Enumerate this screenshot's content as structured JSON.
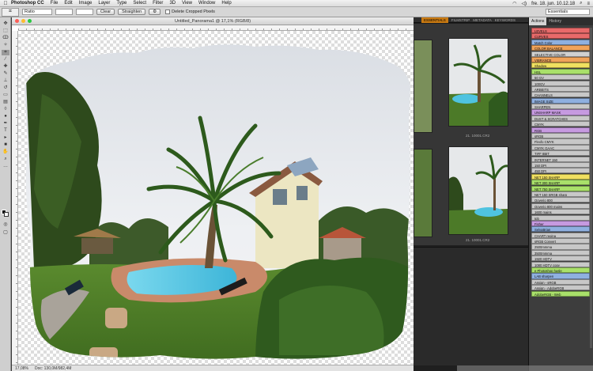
{
  "menubar": {
    "items": [
      "Photoshop CC",
      "File",
      "Edit",
      "Image",
      "Layer",
      "Type",
      "Select",
      "Filter",
      "3D",
      "View",
      "Window",
      "Help"
    ],
    "clock": "fre. 18. jun.  10.12.18"
  },
  "options": {
    "style_value": "Ratio",
    "clear_label": "Clear",
    "straighten_label": "Straighten",
    "delete_cropped_label": "Delete Cropped Pixels",
    "workspace": "Essentials"
  },
  "document": {
    "title": "Untitled_Panorama1 @ 17,1% (RGB/8)",
    "zoom": "17,08%",
    "doc_info": "Doc: 130,0M/982,4M"
  },
  "bridge": {
    "tabs": [
      "ESSENTIALS",
      "FILMSTRIP",
      "METADATA",
      "KEYWORDS"
    ],
    "thumb_labels": [
      "21. 10001.CR2",
      "21. 10001.CR2"
    ]
  },
  "panel": {
    "tabs": [
      "Actions",
      "History"
    ],
    "actions": [
      {
        "label": "LEVELS",
        "color": "#e86a6a"
      },
      {
        "label": "CURVES",
        "color": "#e86a6a"
      },
      {
        "label": "Match Color",
        "color": "#8fb0e0"
      },
      {
        "label": "COLOR BALANCE",
        "color": "#f0a35a"
      },
      {
        "label": "SELECTIVE COLOR",
        "color": "#d0d0d0"
      },
      {
        "label": "VIBRANCE",
        "color": "#f0a35a"
      },
      {
        "label": "Shadow",
        "color": "#f0e060"
      },
      {
        "label": "HSL",
        "color": "#a9e06a"
      },
      {
        "label": "50 GV",
        "color": "#c8c8c8"
      },
      {
        "label": "100GV",
        "color": "#c8c8c8"
      },
      {
        "label": "ARBEITS",
        "color": "#c8c8c8"
      },
      {
        "label": "CHANNELS",
        "color": "#c8c8c8"
      },
      {
        "label": "IMAGE SIZE",
        "color": "#8fb0e0"
      },
      {
        "label": "SHARPEN",
        "color": "#c8c8c8"
      },
      {
        "label": "UNSHARP MASK",
        "color": "#c69ae0"
      },
      {
        "label": "DUST & SCRATCHES",
        "color": "#c8c8c8"
      },
      {
        "label": "CMYK",
        "color": "#c8c8c8"
      },
      {
        "label": "RGB",
        "color": "#c69ae0"
      },
      {
        "label": "sRGB",
        "color": "#c8c8c8"
      },
      {
        "label": "Flexfo CMYK",
        "color": "#c8c8c8"
      },
      {
        "label": "CMYK GAAC",
        "color": "#c8c8c8"
      },
      {
        "label": "TIFF 8BIT",
        "color": "#c8c8c8"
      },
      {
        "label": "INTERNET 150",
        "color": "#c8c8c8"
      },
      {
        "label": "150 DPI",
        "color": "#c8c8c8"
      },
      {
        "label": "450 DPI",
        "color": "#c8c8c8"
      },
      {
        "label": "NET 150 SHARP",
        "color": "#f0e060"
      },
      {
        "label": "NET 300 SHARP",
        "color": "#a9e06a"
      },
      {
        "label": "NET 750 SHARP",
        "color": "#a9e06a"
      },
      {
        "label": "NET 150 SRGB sharp",
        "color": "#c8c8c8"
      },
      {
        "label": "Qoverjo 800",
        "color": "#c8c8c8"
      },
      {
        "label": "Qoverjo 800 mains",
        "color": "#c8c8c8"
      },
      {
        "label": "1600 mains",
        "color": "#c8c8c8"
      },
      {
        "label": "Ipb",
        "color": "#c8c8c8"
      },
      {
        "label": "Fisher",
        "color": "#c69ae0"
      },
      {
        "label": "SelvaBrian",
        "color": "#8fb0e0"
      },
      {
        "label": "CHART regina",
        "color": "#c8c8c8"
      },
      {
        "label": "sRGB Convert",
        "color": "#c8c8c8"
      },
      {
        "label": "2500mmma",
        "color": "#c8c8c8"
      },
      {
        "label": "3500mmma",
        "color": "#c8c8c8"
      },
      {
        "label": "1920 HDTV",
        "color": "#c8c8c8"
      },
      {
        "label": "1080 HDTV copy",
        "color": "#c8c8c8"
      },
      {
        "label": "e Photoshop hasle",
        "color": "#a9e06a"
      },
      {
        "label": "LAB sharpen",
        "color": "#8fb0e0"
      },
      {
        "label": "Assign - sRGB",
        "color": "#c8c8c8"
      },
      {
        "label": "Assign - AdobeRGB",
        "color": "#c8c8c8"
      },
      {
        "label": "AdobeRGB - Web",
        "color": "#a9e06a"
      }
    ]
  },
  "colors": {
    "canvas_sky": "#e8eaee",
    "lawn": "#4f7d2a",
    "pool": "#4fc3e0"
  }
}
